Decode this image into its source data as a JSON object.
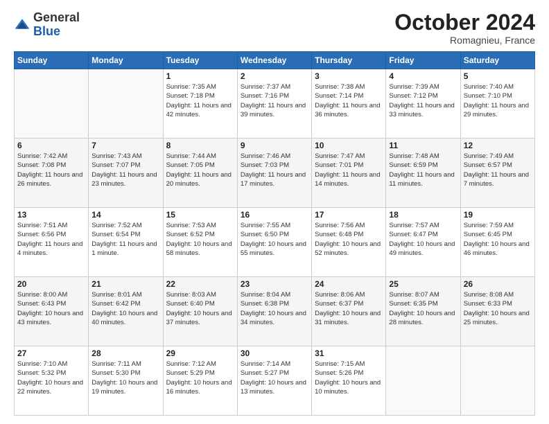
{
  "header": {
    "logo_general": "General",
    "logo_blue": "Blue",
    "month": "October 2024",
    "location": "Romagnieu, France"
  },
  "weekdays": [
    "Sunday",
    "Monday",
    "Tuesday",
    "Wednesday",
    "Thursday",
    "Friday",
    "Saturday"
  ],
  "weeks": [
    [
      {
        "day": "",
        "sunrise": "",
        "sunset": "",
        "daylight": ""
      },
      {
        "day": "",
        "sunrise": "",
        "sunset": "",
        "daylight": ""
      },
      {
        "day": "1",
        "sunrise": "Sunrise: 7:35 AM",
        "sunset": "Sunset: 7:18 PM",
        "daylight": "Daylight: 11 hours and 42 minutes."
      },
      {
        "day": "2",
        "sunrise": "Sunrise: 7:37 AM",
        "sunset": "Sunset: 7:16 PM",
        "daylight": "Daylight: 11 hours and 39 minutes."
      },
      {
        "day": "3",
        "sunrise": "Sunrise: 7:38 AM",
        "sunset": "Sunset: 7:14 PM",
        "daylight": "Daylight: 11 hours and 36 minutes."
      },
      {
        "day": "4",
        "sunrise": "Sunrise: 7:39 AM",
        "sunset": "Sunset: 7:12 PM",
        "daylight": "Daylight: 11 hours and 33 minutes."
      },
      {
        "day": "5",
        "sunrise": "Sunrise: 7:40 AM",
        "sunset": "Sunset: 7:10 PM",
        "daylight": "Daylight: 11 hours and 29 minutes."
      }
    ],
    [
      {
        "day": "6",
        "sunrise": "Sunrise: 7:42 AM",
        "sunset": "Sunset: 7:08 PM",
        "daylight": "Daylight: 11 hours and 26 minutes."
      },
      {
        "day": "7",
        "sunrise": "Sunrise: 7:43 AM",
        "sunset": "Sunset: 7:07 PM",
        "daylight": "Daylight: 11 hours and 23 minutes."
      },
      {
        "day": "8",
        "sunrise": "Sunrise: 7:44 AM",
        "sunset": "Sunset: 7:05 PM",
        "daylight": "Daylight: 11 hours and 20 minutes."
      },
      {
        "day": "9",
        "sunrise": "Sunrise: 7:46 AM",
        "sunset": "Sunset: 7:03 PM",
        "daylight": "Daylight: 11 hours and 17 minutes."
      },
      {
        "day": "10",
        "sunrise": "Sunrise: 7:47 AM",
        "sunset": "Sunset: 7:01 PM",
        "daylight": "Daylight: 11 hours and 14 minutes."
      },
      {
        "day": "11",
        "sunrise": "Sunrise: 7:48 AM",
        "sunset": "Sunset: 6:59 PM",
        "daylight": "Daylight: 11 hours and 11 minutes."
      },
      {
        "day": "12",
        "sunrise": "Sunrise: 7:49 AM",
        "sunset": "Sunset: 6:57 PM",
        "daylight": "Daylight: 11 hours and 7 minutes."
      }
    ],
    [
      {
        "day": "13",
        "sunrise": "Sunrise: 7:51 AM",
        "sunset": "Sunset: 6:56 PM",
        "daylight": "Daylight: 11 hours and 4 minutes."
      },
      {
        "day": "14",
        "sunrise": "Sunrise: 7:52 AM",
        "sunset": "Sunset: 6:54 PM",
        "daylight": "Daylight: 11 hours and 1 minute."
      },
      {
        "day": "15",
        "sunrise": "Sunrise: 7:53 AM",
        "sunset": "Sunset: 6:52 PM",
        "daylight": "Daylight: 10 hours and 58 minutes."
      },
      {
        "day": "16",
        "sunrise": "Sunrise: 7:55 AM",
        "sunset": "Sunset: 6:50 PM",
        "daylight": "Daylight: 10 hours and 55 minutes."
      },
      {
        "day": "17",
        "sunrise": "Sunrise: 7:56 AM",
        "sunset": "Sunset: 6:48 PM",
        "daylight": "Daylight: 10 hours and 52 minutes."
      },
      {
        "day": "18",
        "sunrise": "Sunrise: 7:57 AM",
        "sunset": "Sunset: 6:47 PM",
        "daylight": "Daylight: 10 hours and 49 minutes."
      },
      {
        "day": "19",
        "sunrise": "Sunrise: 7:59 AM",
        "sunset": "Sunset: 6:45 PM",
        "daylight": "Daylight: 10 hours and 46 minutes."
      }
    ],
    [
      {
        "day": "20",
        "sunrise": "Sunrise: 8:00 AM",
        "sunset": "Sunset: 6:43 PM",
        "daylight": "Daylight: 10 hours and 43 minutes."
      },
      {
        "day": "21",
        "sunrise": "Sunrise: 8:01 AM",
        "sunset": "Sunset: 6:42 PM",
        "daylight": "Daylight: 10 hours and 40 minutes."
      },
      {
        "day": "22",
        "sunrise": "Sunrise: 8:03 AM",
        "sunset": "Sunset: 6:40 PM",
        "daylight": "Daylight: 10 hours and 37 minutes."
      },
      {
        "day": "23",
        "sunrise": "Sunrise: 8:04 AM",
        "sunset": "Sunset: 6:38 PM",
        "daylight": "Daylight: 10 hours and 34 minutes."
      },
      {
        "day": "24",
        "sunrise": "Sunrise: 8:06 AM",
        "sunset": "Sunset: 6:37 PM",
        "daylight": "Daylight: 10 hours and 31 minutes."
      },
      {
        "day": "25",
        "sunrise": "Sunrise: 8:07 AM",
        "sunset": "Sunset: 6:35 PM",
        "daylight": "Daylight: 10 hours and 28 minutes."
      },
      {
        "day": "26",
        "sunrise": "Sunrise: 8:08 AM",
        "sunset": "Sunset: 6:33 PM",
        "daylight": "Daylight: 10 hours and 25 minutes."
      }
    ],
    [
      {
        "day": "27",
        "sunrise": "Sunrise: 7:10 AM",
        "sunset": "Sunset: 5:32 PM",
        "daylight": "Daylight: 10 hours and 22 minutes."
      },
      {
        "day": "28",
        "sunrise": "Sunrise: 7:11 AM",
        "sunset": "Sunset: 5:30 PM",
        "daylight": "Daylight: 10 hours and 19 minutes."
      },
      {
        "day": "29",
        "sunrise": "Sunrise: 7:12 AM",
        "sunset": "Sunset: 5:29 PM",
        "daylight": "Daylight: 10 hours and 16 minutes."
      },
      {
        "day": "30",
        "sunrise": "Sunrise: 7:14 AM",
        "sunset": "Sunset: 5:27 PM",
        "daylight": "Daylight: 10 hours and 13 minutes."
      },
      {
        "day": "31",
        "sunrise": "Sunrise: 7:15 AM",
        "sunset": "Sunset: 5:26 PM",
        "daylight": "Daylight: 10 hours and 10 minutes."
      },
      {
        "day": "",
        "sunrise": "",
        "sunset": "",
        "daylight": ""
      },
      {
        "day": "",
        "sunrise": "",
        "sunset": "",
        "daylight": ""
      }
    ]
  ]
}
